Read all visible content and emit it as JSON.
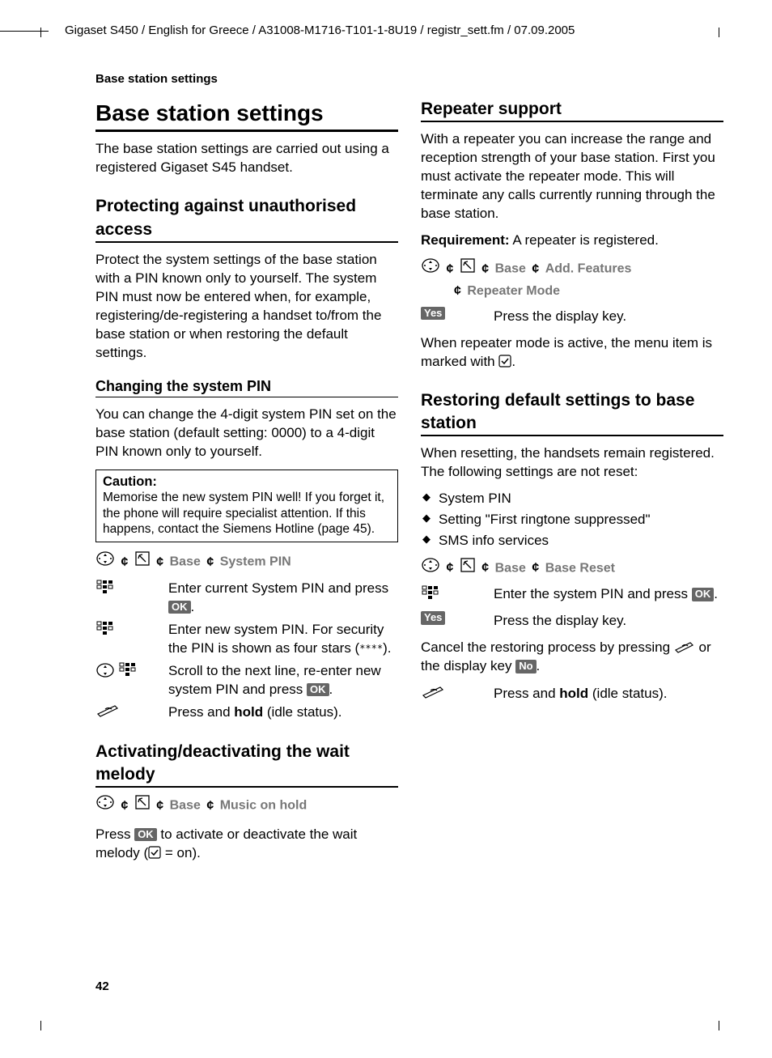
{
  "header": "Gigaset S450 / English for Greece / A31008-M1716-T101-1-8U19 / registr_sett.fm / 07.09.2005",
  "running_head": "Base station settings",
  "page_number": "42",
  "left": {
    "h1": "Base station settings",
    "intro": "The base station settings are carried out using a registered Gigaset S45 handset.",
    "h2a": "Protecting against unauthorised access",
    "p2": "Protect the system settings of the base station with a PIN known only to yourself. The system PIN must now be entered when, for example, registering/de-registering a handset to/from the base station or when restoring the default settings.",
    "h3a": "Changing the system PIN",
    "p3": "You can change the 4-digit system PIN set on the base station (default setting: 0000) to a 4-digit PIN known only to yourself.",
    "caution_title": "Caution:",
    "caution_body": "Memorise the new system PIN well! If you forget it, the phone will require specialist attention. If this happens, contact the Siemens Hotline (page 45).",
    "path1": {
      "a": "Base",
      "b": "System PIN"
    },
    "step1a_pre": "Enter current System PIN and press ",
    "step1b": "Enter new system PIN. For security the PIN is shown as four stars (",
    "step1b_end": ").",
    "step1c_pre": "Scroll to the next line, re-enter new system PIN and press ",
    "step1d_pre": "Press and ",
    "step1d_bold": "hold",
    "step1d_post": " (idle status).",
    "h2b": "Activating/deactivating the wait melody",
    "path2": {
      "a": "Base",
      "b": "Music on hold"
    },
    "p4_pre": "Press ",
    "p4_mid": " to activate or deactivate the wait melody (",
    "p4_post": " = on)."
  },
  "right": {
    "h2a": "Repeater support",
    "p1": "With a repeater you can increase the range and reception strength of your base station. First you must activate the repeater mode. This will terminate any calls currently running through the base station.",
    "req_label": "Requirement:",
    "req_text": " A repeater is registered.",
    "path1": {
      "a": "Base",
      "b": "Add. Features",
      "c": "Repeater Mode"
    },
    "yes": "Yes",
    "no": "No",
    "ok": "OK",
    "step_yes": "Press the display key.",
    "p2_pre": "When repeater mode is active, the menu item is marked with ",
    "p2_post": ".",
    "h2b": "Restoring default settings to base station",
    "p3": "When resetting, the handsets remain registered. The following settings are not reset:",
    "bullets": [
      "System PIN",
      "Setting \"First ringtone suppressed\"",
      "SMS info services"
    ],
    "path2": {
      "a": "Base",
      "b": "Base Reset"
    },
    "step_enter_pre": "Enter the system PIN and press ",
    "step_yes2": "Press the display key.",
    "p4_pre": "Cancel the restoring process by pressing ",
    "p4_mid": " or the display key ",
    "p4_post": ".",
    "step_hold_pre": "Press and ",
    "step_hold_bold": "hold",
    "step_hold_post": " (idle status)."
  }
}
